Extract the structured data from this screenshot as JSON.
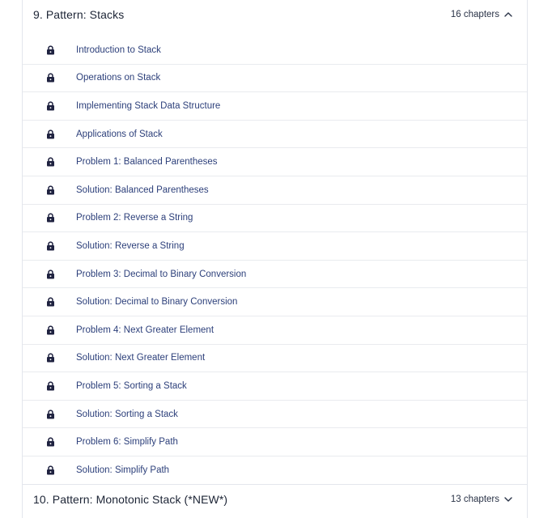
{
  "sections": [
    {
      "title": "9.  Pattern: Stacks",
      "chapters": "16 chapters",
      "expanded": true,
      "lessons": [
        {
          "label": "Introduction to Stack",
          "locked": true
        },
        {
          "label": "Operations on Stack",
          "locked": true
        },
        {
          "label": "Implementing Stack Data Structure",
          "locked": true
        },
        {
          "label": "Applications of Stack",
          "locked": true
        },
        {
          "label": "Problem 1: Balanced Parentheses",
          "locked": true
        },
        {
          "label": "Solution: Balanced Parentheses",
          "locked": true
        },
        {
          "label": "Problem 2: Reverse a String",
          "locked": true
        },
        {
          "label": "Solution: Reverse a String",
          "locked": true
        },
        {
          "label": "Problem 3: Decimal to Binary Conversion",
          "locked": true
        },
        {
          "label": "Solution: Decimal to Binary Conversion",
          "locked": true
        },
        {
          "label": "Problem 4: Next Greater Element",
          "locked": true
        },
        {
          "label": "Solution: Next Greater Element",
          "locked": true
        },
        {
          "label": "Problem 5: Sorting a Stack",
          "locked": true
        },
        {
          "label": "Solution: Sorting a Stack",
          "locked": true
        },
        {
          "label": "Problem 6: Simplify Path",
          "locked": true
        },
        {
          "label": "Solution: Simplify Path",
          "locked": true
        }
      ]
    },
    {
      "title": "10.  Pattern: Monotonic Stack (*NEW*)",
      "chapters": "13 chapters",
      "expanded": false
    }
  ],
  "colors": {
    "lesson_text": "#2c3f7a",
    "lock_icon": "#1f2240",
    "header_text": "#1c2435",
    "divider": "#e9ebef"
  },
  "icons": {
    "lesson": "lock-icon",
    "expanded": "chevron-up-icon",
    "collapsed": "chevron-down-icon"
  }
}
